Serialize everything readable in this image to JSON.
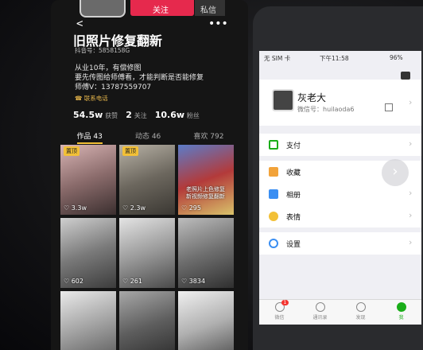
{
  "left_phone": {
    "top": {
      "follow_label": "关注",
      "msg_label": "私信"
    },
    "profile": {
      "name": "旧照片修复翻新",
      "douyin_id": "抖音号：5858158G",
      "bio_line1": "从业10年，有偿修图",
      "bio_line2": "要先传图给师傅看，才能判断是否能修复",
      "bio_line3": "师傅V：13787559707",
      "contact_label": "联系电话"
    },
    "stats": [
      {
        "value": "54.5w",
        "label": "获赞"
      },
      {
        "value": "2",
        "label": "关注"
      },
      {
        "value": "10.6w",
        "label": "粉丝"
      }
    ],
    "tabs": [
      "作品 43",
      "动态 46",
      "喜欢 792"
    ],
    "pin_label": "置顶",
    "grid": [
      {
        "likes": "3.3w",
        "pinned": true
      },
      {
        "likes": "2.3w",
        "pinned": true
      },
      {
        "likes": "295",
        "pinned": false,
        "caption": "老照片上色修复\n新视频修复翻新"
      },
      {
        "likes": "602"
      },
      {
        "likes": "261"
      },
      {
        "likes": "3834"
      },
      {
        "likes": ""
      },
      {
        "likes": ""
      },
      {
        "likes": ""
      }
    ]
  },
  "right_phone": {
    "status": {
      "carrier": "无 SIM 卡",
      "time": "下午11:58",
      "battery": "96%"
    },
    "profile": {
      "name": "灰老大",
      "wechat_id": "微信号：huilaoda6"
    },
    "menu": [
      {
        "label": "支付",
        "color": "#1aad19"
      },
      {
        "label": "收藏",
        "color": "#f2a33a"
      },
      {
        "label": "相册",
        "color": "#3a8ef2"
      },
      {
        "label": "表情",
        "color": "#f2c037"
      },
      {
        "label": "设置",
        "color": "#3a8ef2"
      }
    ],
    "tabbar": [
      {
        "label": "微信",
        "badge": "1"
      },
      {
        "label": "通讯录"
      },
      {
        "label": "发现"
      },
      {
        "label": "我",
        "active": true
      }
    ]
  }
}
